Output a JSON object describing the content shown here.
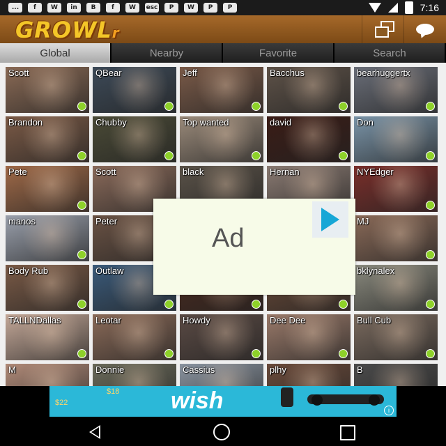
{
  "status_bar": {
    "time": "7:16",
    "notification_icons": [
      "...",
      "f",
      "W",
      "in",
      "B",
      "f",
      "W",
      "esc",
      "P",
      "W",
      "P",
      "P"
    ]
  },
  "app": {
    "logo": "GROWL",
    "logo_suffix": "r"
  },
  "tabs": [
    {
      "label": "Global",
      "active": true
    },
    {
      "label": "Nearby",
      "active": false
    },
    {
      "label": "Favorite",
      "active": false
    },
    {
      "label": "Search",
      "active": false
    }
  ],
  "profiles": [
    [
      {
        "name": "Scott",
        "color": "#8a6a55",
        "online": true
      },
      {
        "name": "QBear",
        "color": "#3d4a58",
        "online": true
      },
      {
        "name": "Jeff",
        "color": "#7a5a48",
        "online": true
      },
      {
        "name": "Bacchus",
        "color": "#5e5248",
        "online": true
      },
      {
        "name": "bearhuggertx",
        "color": "#6a6e78",
        "online": true
      }
    ],
    [
      {
        "name": "Brandon",
        "color": "#7b5a46",
        "online": true
      },
      {
        "name": "Chubby",
        "color": "#4a4a36",
        "online": true
      },
      {
        "name": "Top wanted",
        "color": "#9a8a7a",
        "online": true
      },
      {
        "name": "david",
        "color": "#3a1c16",
        "online": true
      },
      {
        "name": "Don",
        "color": "#7a94a8",
        "online": true
      }
    ],
    [
      {
        "name": "Pete",
        "color": "#a06a48",
        "online": true
      },
      {
        "name": "Scott",
        "color": "#8a6a5a",
        "online": true
      },
      {
        "name": "black",
        "color": "#5a5248",
        "online": true
      },
      {
        "name": "Hernan",
        "color": "#8a7a72",
        "online": true
      },
      {
        "name": "NYEdger",
        "color": "#7a2e2a",
        "online": true
      }
    ],
    [
      {
        "name": "manos",
        "color": "#9aa0ac",
        "online": true
      },
      {
        "name": "Peter",
        "color": "#6a5244",
        "online": true
      },
      {
        "name": "",
        "color": "#5a4a40",
        "online": true
      },
      {
        "name": "",
        "color": "#6a5a50",
        "online": true
      },
      {
        "name": "MJ",
        "color": "#8a6a58",
        "online": true
      }
    ],
    [
      {
        "name": "Body Rub",
        "color": "#7a5a46",
        "online": true
      },
      {
        "name": "Outlaw",
        "color": "#3a5a7a",
        "online": true
      },
      {
        "name": "",
        "color": "#4a2a1e",
        "online": true
      },
      {
        "name": "",
        "color": "#6a4a38",
        "online": true
      },
      {
        "name": "bklynalex",
        "color": "#8a8a7e",
        "online": true
      }
    ],
    [
      {
        "name": "TALLNDallas",
        "color": "#c4a898",
        "online": true
      },
      {
        "name": "Leotar",
        "color": "#8a6a58",
        "online": true
      },
      {
        "name": "Howdy",
        "color": "#5a4a44",
        "online": true
      },
      {
        "name": "Dee Dee",
        "color": "#9a7a6a",
        "online": true
      },
      {
        "name": "Bull Cub",
        "color": "#7a6a5e",
        "online": true
      }
    ],
    [
      {
        "name": "M",
        "color": "#b08a78",
        "online": false
      },
      {
        "name": "Donnie",
        "color": "#6a6a5a",
        "online": false
      },
      {
        "name": "Cassius",
        "color": "#8a94a0",
        "online": false
      },
      {
        "name": "plhy",
        "color": "#6a4a3a",
        "online": false
      },
      {
        "name": "B",
        "color": "#4a4a4a",
        "online": false
      }
    ]
  ],
  "ad_overlay": {
    "label": "Ad"
  },
  "banner": {
    "brand": "wish",
    "price_left": "$22",
    "price_mid": "$18",
    "info": "i"
  }
}
